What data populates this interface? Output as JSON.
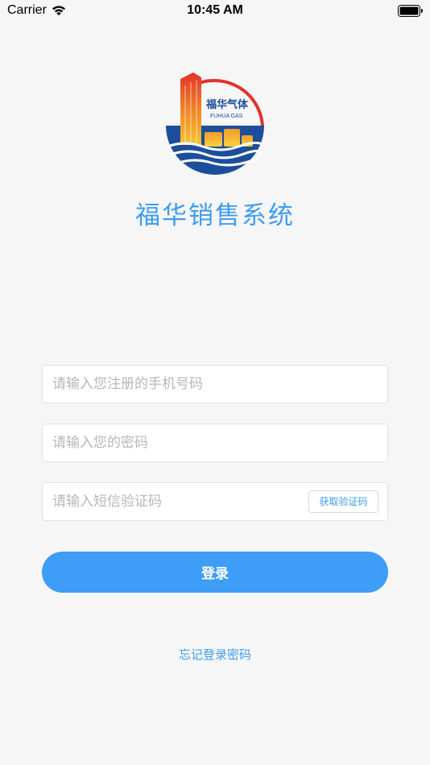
{
  "status_bar": {
    "carrier": "Carrier",
    "time": "10:45 AM"
  },
  "logo": {
    "text_cn": "福华气体",
    "text_en": "FUHUA GAS"
  },
  "app_title": "福华销售系统",
  "form": {
    "phone_placeholder": "请输入您注册的手机号码",
    "password_placeholder": "请输入您的密码",
    "code_placeholder": "请输入短信验证码",
    "get_code_label": "获取验证码",
    "login_label": "登录"
  },
  "forgot_password_label": "忘记登录密码",
  "colors": {
    "accent": "#3d9df7",
    "background": "#f6f6f6"
  }
}
